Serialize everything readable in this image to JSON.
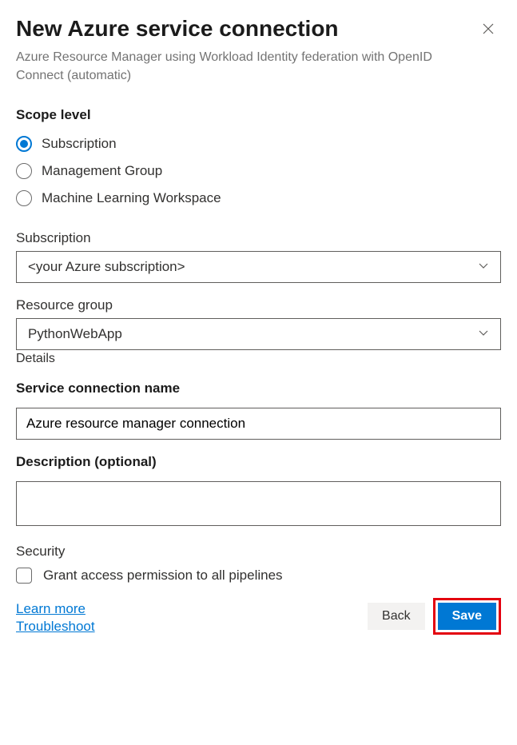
{
  "header": {
    "title": "New Azure service connection",
    "subtitle": "Azure Resource Manager using Workload Identity federation with OpenID Connect (automatic)"
  },
  "scope": {
    "heading": "Scope level",
    "options": {
      "subscription": "Subscription",
      "management_group": "Management Group",
      "ml_workspace": "Machine Learning Workspace"
    }
  },
  "fields": {
    "subscription_label": "Subscription",
    "subscription_value": "<your Azure subscription>",
    "resource_group_label": "Resource group",
    "resource_group_value": "PythonWebApp",
    "details_label": "Details",
    "service_name_label": "Service connection name",
    "service_name_value": "Azure resource manager connection",
    "description_label": "Description (optional)",
    "description_value": ""
  },
  "security": {
    "heading": "Security",
    "checkbox_label": "Grant access permission to all pipelines"
  },
  "footer": {
    "learn_more": "Learn more",
    "troubleshoot": "Troubleshoot",
    "back": "Back",
    "save": "Save"
  }
}
